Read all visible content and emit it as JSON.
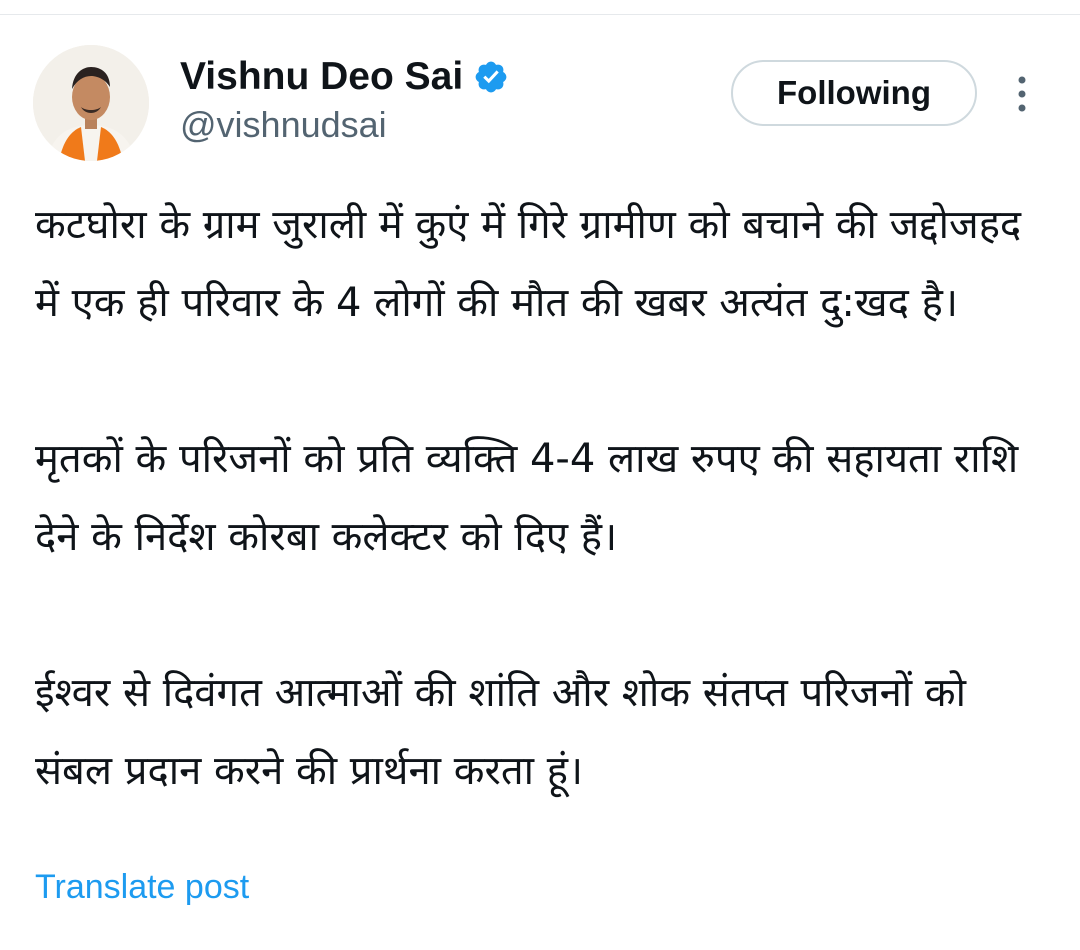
{
  "author": {
    "display_name": "Vishnu Deo Sai",
    "handle": "@vishnudsai",
    "verified": true,
    "verified_color": "#1d9bf0"
  },
  "follow_button": {
    "label": "Following"
  },
  "more_menu": {
    "icon": "more-vertical-icon"
  },
  "tweet": {
    "paragraphs": [
      "कटघोरा के ग्राम जुराली में कुएं में गिरे ग्रामीण को बचाने की जद्दोजहद में एक ही परिवार के 4 लोगों की मौत की खबर अत्यंत दु:खद है।",
      "मृतकों के परिजनों को प्रति व्यक्ति 4-4 लाख रुपए की सहायता राशि देने के निर्देश कोरबा कलेक्टर को दिए हैं।",
      "ईश्वर से दिवंगत आत्माओं की शांति और शोक संतप्त परिजनों को संबल प्रदान करने की प्रार्थना करता हूं।"
    ]
  },
  "translate_link": {
    "label": "Translate post",
    "color": "#1d9bf0"
  }
}
